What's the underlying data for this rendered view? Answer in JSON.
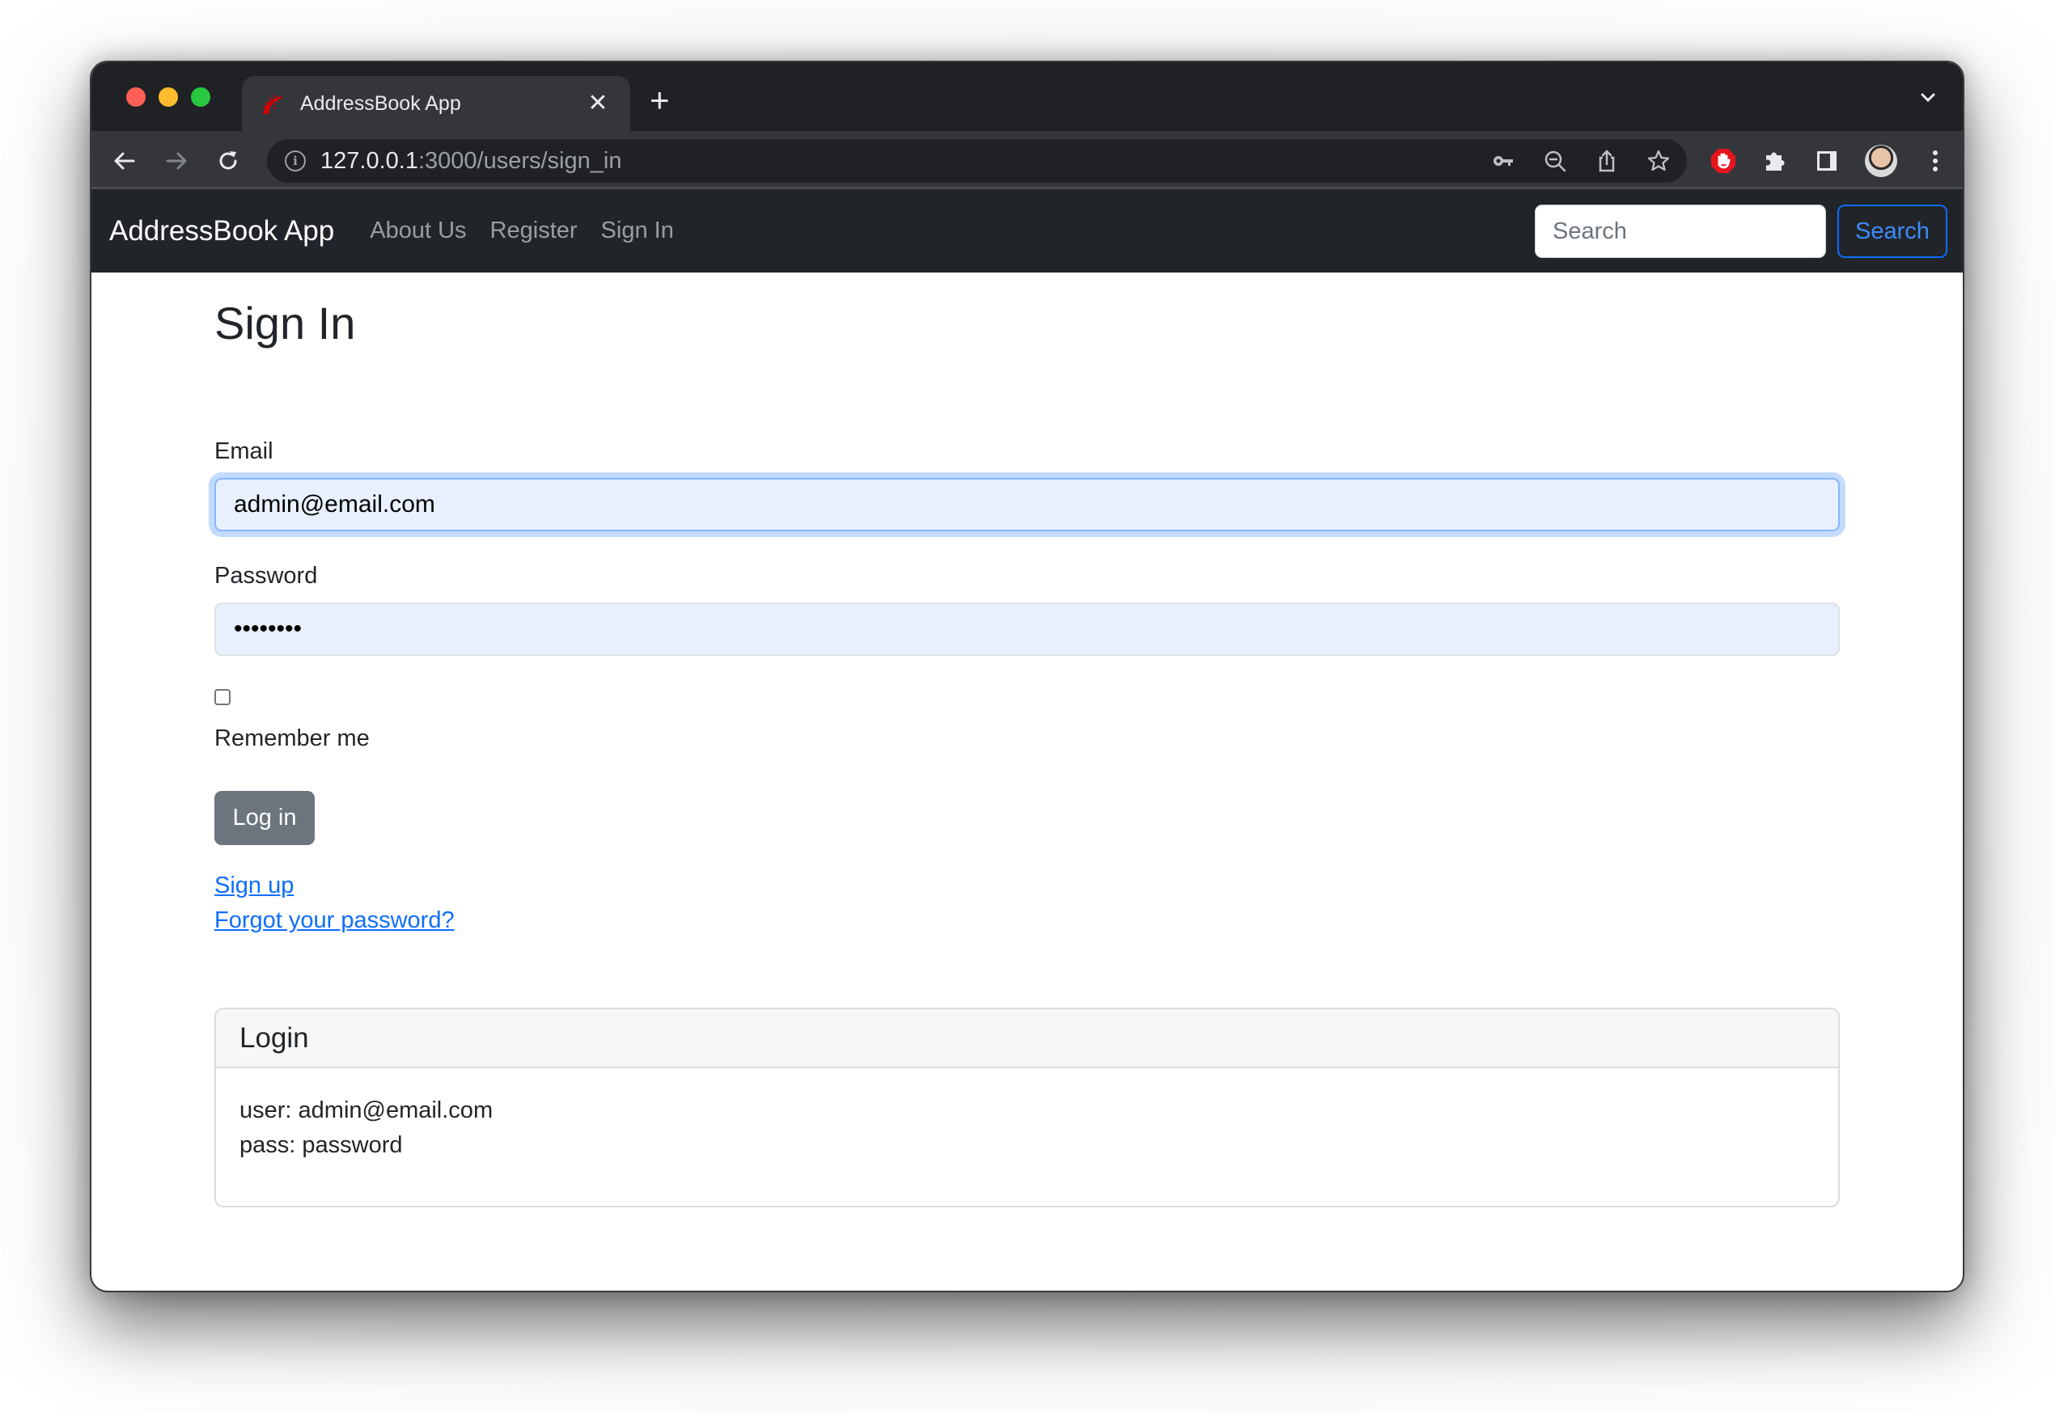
{
  "browser": {
    "tab": {
      "title": "AddressBook App",
      "favicon": "rails-logo-icon",
      "close_glyph": "✕"
    },
    "new_tab_glyph": "+",
    "address_bar": {
      "host": "127.0.0.1",
      "path": ":3000/users/sign_in"
    },
    "omnibox_icons": [
      "key-icon",
      "zoom-out-icon",
      "share-icon",
      "bookmark-star-icon"
    ],
    "extension_icons": [
      "adblock-icon",
      "extensions-puzzle-icon",
      "side-panel-icon",
      "profile-avatar",
      "menu-kebab-icon"
    ]
  },
  "navbar": {
    "brand": "AddressBook App",
    "links": [
      {
        "label": "About Us"
      },
      {
        "label": "Register"
      },
      {
        "label": "Sign In"
      }
    ],
    "search": {
      "placeholder": "Search",
      "value": "",
      "button_label": "Search"
    }
  },
  "page": {
    "title": "Sign In",
    "form": {
      "email_label": "Email",
      "email_value": "admin@email.com",
      "password_label": "Password",
      "password_value": "password",
      "remember_label": "Remember me",
      "remember_checked": false,
      "submit_label": "Log in"
    },
    "links": {
      "sign_up": "Sign up",
      "forgot_password": "Forgot your password?"
    },
    "card": {
      "header": "Login",
      "lines": [
        "user: admin@email.com",
        "pass: password"
      ]
    }
  },
  "colors": {
    "navbar_bg": "#212529",
    "primary": "#0d6efd",
    "secondary_button": "#6c757d",
    "autofill_bg": "#e8f0fe"
  }
}
